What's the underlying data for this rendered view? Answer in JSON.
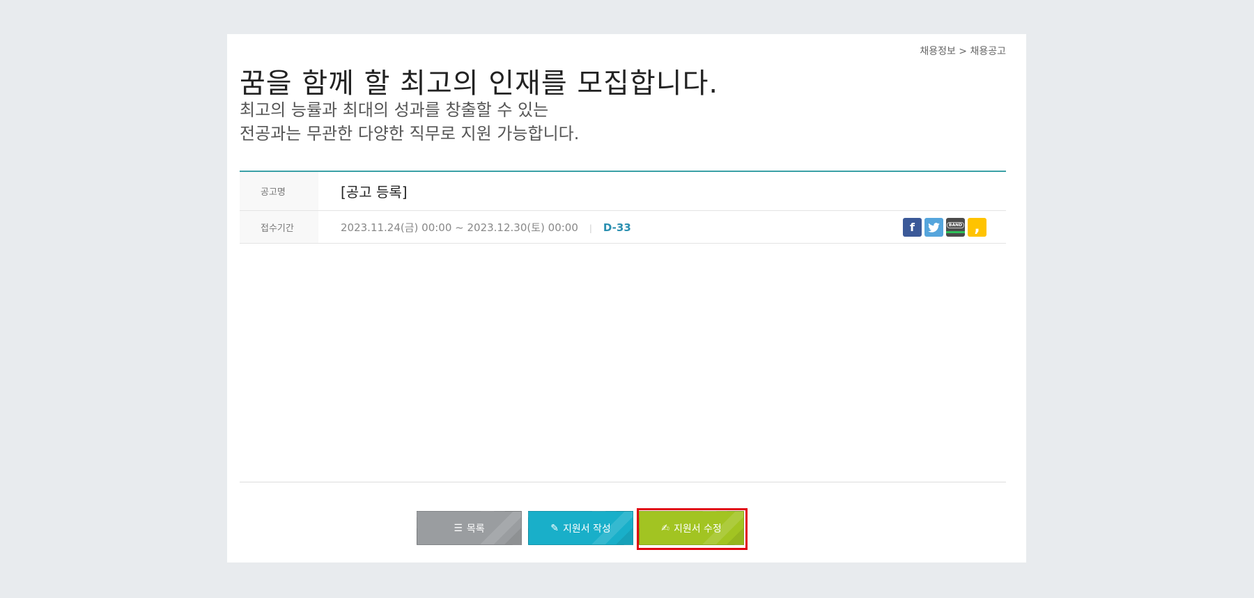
{
  "breadcrumb": "채용정보 > 채용공고",
  "title": "꿈을 함께 할 최고의 인재를 모집합니다.",
  "subtitle": [
    "최고의 능률과 최대의 성과를 창출할 수 있는",
    "전공과는 무관한 다양한 직무로 지원 가능합니다."
  ],
  "posting": {
    "name_label": "공고명",
    "name": "[공고 등록]",
    "period_label": "접수기간",
    "period": "2023.11.24(금) 00:00 ~ 2023.12.30(토) 00:00",
    "separator": "|",
    "dday": "D-33"
  },
  "social": {
    "facebook": "f",
    "band": "BAND",
    "kakao": ","
  },
  "buttons": {
    "list": "목록",
    "write": "지원서 작성",
    "edit": "지원서 수정"
  }
}
